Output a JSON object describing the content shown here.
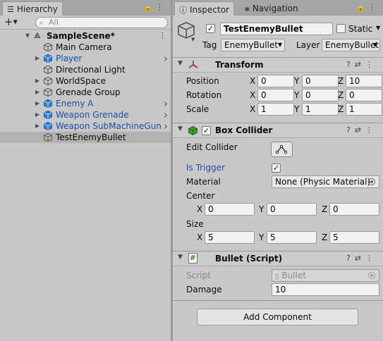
{
  "hierarchy": {
    "tab_label": "Hierarchy",
    "search_placeholder": "All",
    "scene": "SampleScene*",
    "items": [
      {
        "label": "Main Camera",
        "prefab": false,
        "has_children": false
      },
      {
        "label": "Player",
        "prefab": true,
        "has_children": true
      },
      {
        "label": "Directional Light",
        "prefab": false,
        "has_children": false
      },
      {
        "label": "WorldSpace",
        "prefab": false,
        "has_children": true
      },
      {
        "label": "Grenade Group",
        "prefab": false,
        "has_children": true
      },
      {
        "label": "Enemy A",
        "prefab": true,
        "has_children": true
      },
      {
        "label": "Weapon Grenade",
        "prefab": true,
        "has_children": true
      },
      {
        "label": "Weapon SubMachineGun",
        "prefab": true,
        "has_children": true
      },
      {
        "label": "TestEnemyBullet",
        "prefab": false,
        "has_children": false,
        "selected": true
      }
    ]
  },
  "inspector": {
    "tab_label": "Inspector",
    "nav_tab_label": "Navigation",
    "object_name": "TestEnemyBullet",
    "static_label": "Static",
    "tag_label": "Tag",
    "tag_value": "EnemyBullet",
    "layer_label": "Layer",
    "layer_value": "EnemyBullet",
    "transform": {
      "title": "Transform",
      "position_label": "Position",
      "rotation_label": "Rotation",
      "scale_label": "Scale",
      "position": {
        "x": "0",
        "y": "0",
        "z": "10"
      },
      "rotation": {
        "x": "0",
        "y": "0",
        "z": "0"
      },
      "scale": {
        "x": "1",
        "y": "1",
        "z": "1"
      }
    },
    "box_collider": {
      "title": "Box Collider",
      "edit_collider_label": "Edit Collider",
      "is_trigger_label": "Is Trigger",
      "is_trigger": true,
      "material_label": "Material",
      "material_value": "None (Physic Material)",
      "center_label": "Center",
      "center": {
        "x": "0",
        "y": "0",
        "z": "0"
      },
      "size_label": "Size",
      "size": {
        "x": "5",
        "y": "5",
        "z": "5"
      }
    },
    "bullet_script": {
      "title": "Bullet (Script)",
      "script_label": "Script",
      "script_value": "Bullet",
      "damage_label": "Damage",
      "damage_value": "10"
    },
    "add_component_label": "Add Component"
  },
  "axis_labels": {
    "x": "X",
    "y": "Y",
    "z": "Z"
  },
  "icons": {
    "hierarchy_tab": "list-icon",
    "inspector_tab": "info-icon",
    "navigation_tab": "navigation-icon",
    "lock": "lock-icon",
    "menu": "kebab-menu-icon",
    "help": "help-icon",
    "presets": "sliders-icon"
  },
  "colors": {
    "prefab_text": "#1a4fa0",
    "cube_blue": "#2a7fd6",
    "collider_green": "#3a9a3a",
    "selection": "#b2b2b2",
    "link_blue": "#1f4fa8"
  }
}
